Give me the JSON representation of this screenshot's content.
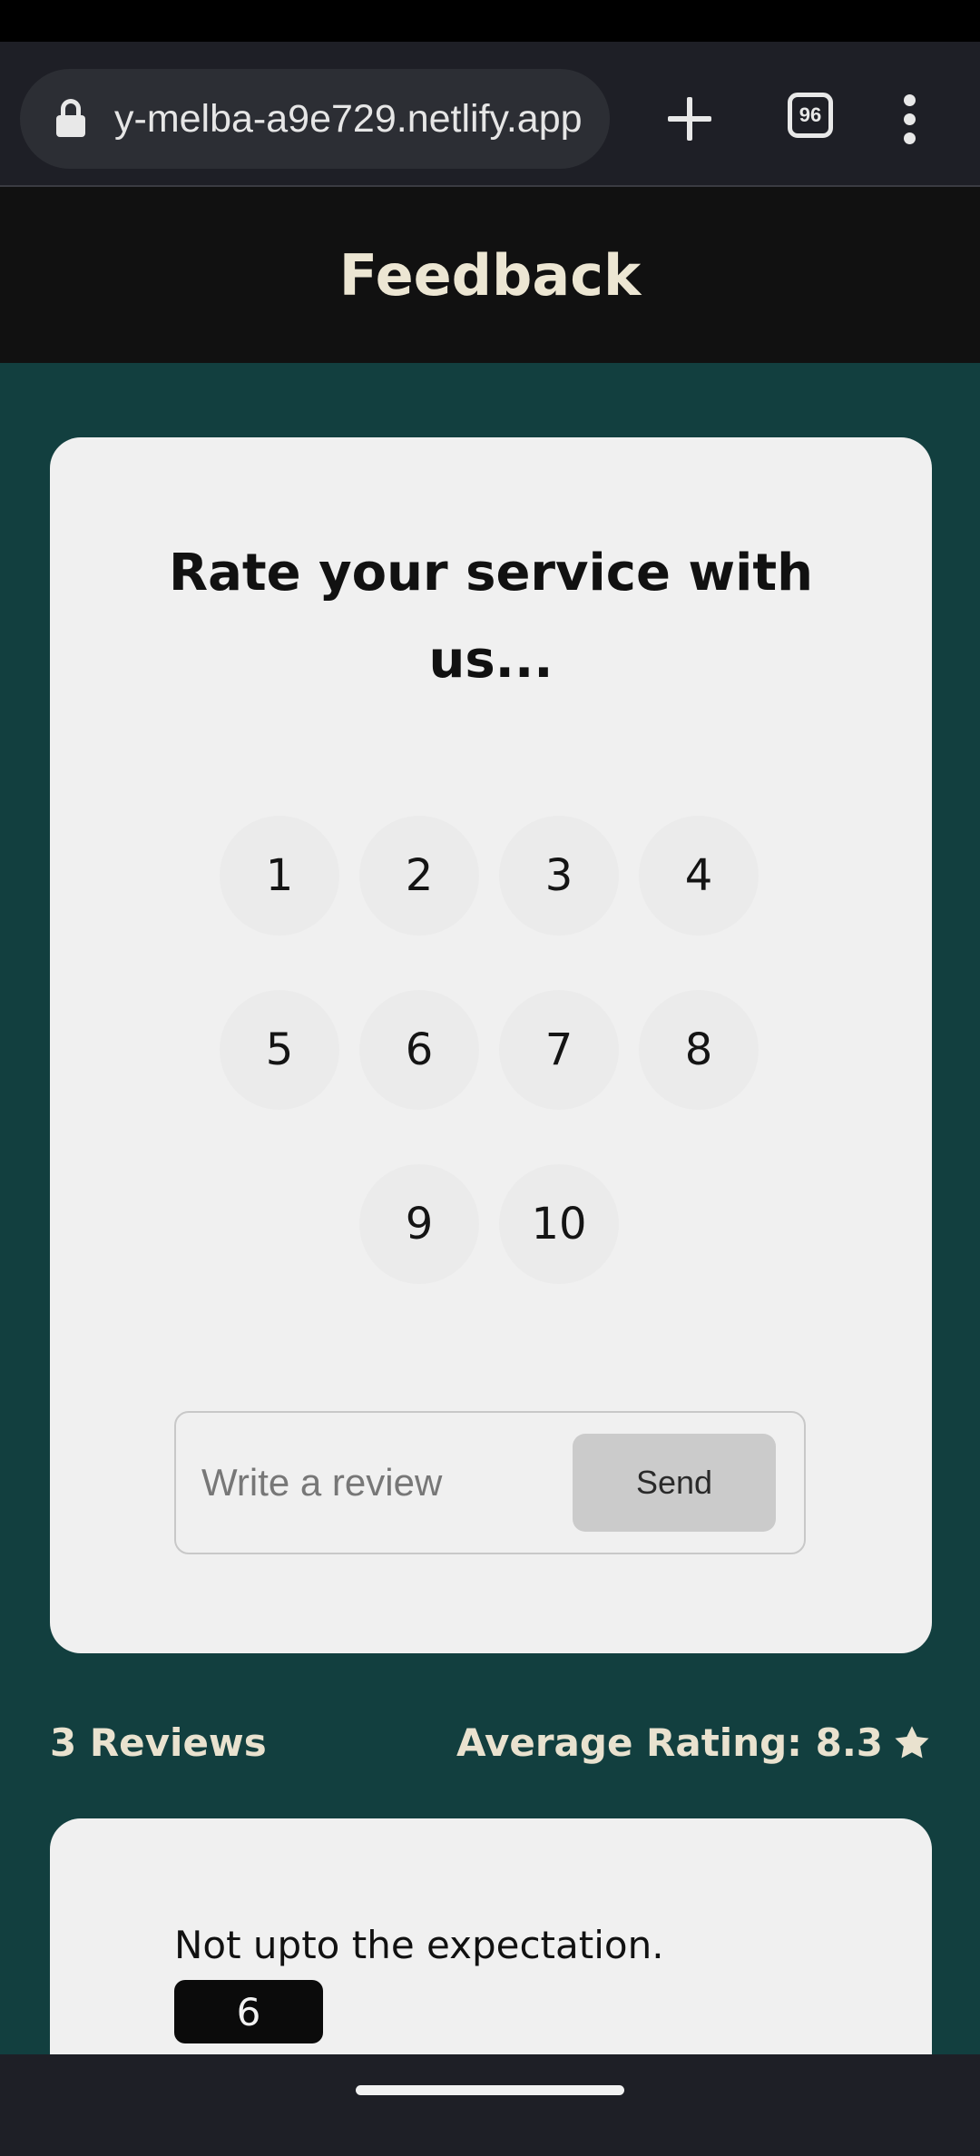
{
  "browser": {
    "url": "y-melba-a9e729.netlify.app",
    "tab_count": "96",
    "icons": {
      "lock": "lock-icon",
      "new_tab": "plus-icon",
      "tabs": "tabs-icon",
      "menu": "more-vert-icon"
    }
  },
  "header": {
    "title": "Feedback"
  },
  "rating_card": {
    "heading": "Rate your service with us...",
    "options": [
      "1",
      "2",
      "3",
      "4",
      "5",
      "6",
      "7",
      "8",
      "9",
      "10"
    ],
    "review_placeholder": "Write a review",
    "send_label": "Send"
  },
  "stats": {
    "review_count": "3 Reviews",
    "average_rating": "Average Rating: 8.3",
    "star_icon": "star-icon"
  },
  "reviews": [
    {
      "text": "Not upto the expectation.",
      "rating": "6"
    }
  ],
  "colors": {
    "background": "#123f3f",
    "header": "#111111",
    "header_text": "#ece6d3",
    "card": "#f0f0f0",
    "send_button": "#cbcbcb",
    "rating_badge": "#0b0b0b"
  }
}
